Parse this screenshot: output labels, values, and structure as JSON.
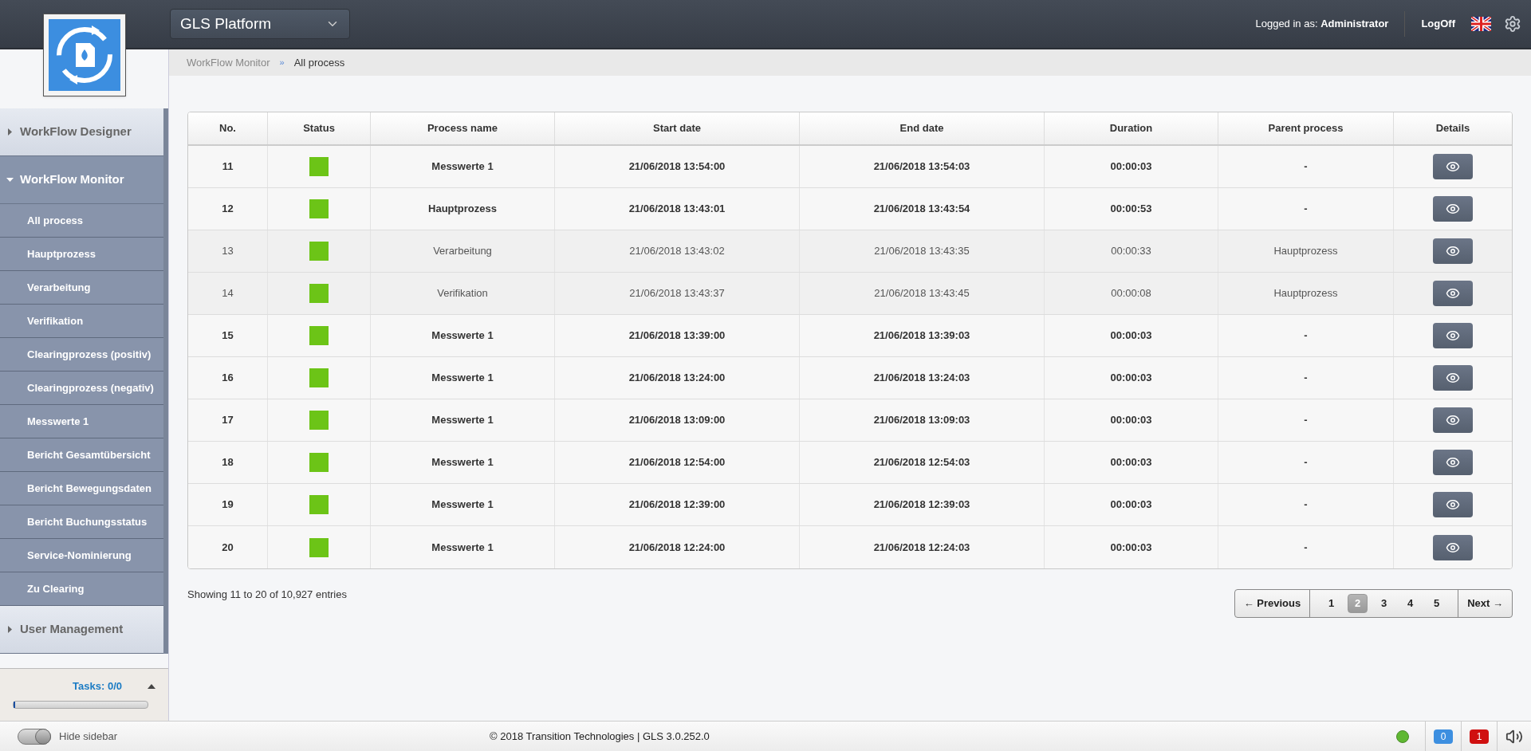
{
  "header": {
    "platform_select": "GLS Platform",
    "logged_in_label": "Logged in as:",
    "user": "Administrator",
    "logoff": "LogOff"
  },
  "breadcrumb": [
    "WorkFlow Monitor",
    "»",
    "All process"
  ],
  "sidebar": {
    "sections": [
      {
        "label": "WorkFlow Designer",
        "expanded": false
      },
      {
        "label": "WorkFlow Monitor",
        "expanded": true,
        "children": [
          {
            "label": "All process"
          },
          {
            "label": "Hauptprozess"
          },
          {
            "label": "Verarbeitung"
          },
          {
            "label": "Verifikation"
          },
          {
            "label": "Clearingprozess (positiv)"
          },
          {
            "label": "Clearingprozess (negativ)"
          },
          {
            "label": "Messwerte 1"
          },
          {
            "label": "Bericht Gesamtübersicht"
          },
          {
            "label": "Bericht Bewegungsdaten"
          },
          {
            "label": "Bericht Buchungsstatus"
          },
          {
            "label": "Service-Nominierung"
          },
          {
            "label": "Zu Clearing"
          }
        ]
      },
      {
        "label": "User Management",
        "expanded": false
      }
    ],
    "tasks": {
      "label": "Tasks: 0/0",
      "level": 0.01
    }
  },
  "table": {
    "columns": [
      "No.",
      "Status",
      "Process name",
      "Start date",
      "End date",
      "Duration",
      "Parent process",
      "Details"
    ],
    "rows": [
      {
        "kind": "main",
        "no": "11",
        "color": "#6cc417",
        "name": "Messwerte 1",
        "start": "21/06/2018 13:54:00",
        "end": "21/06/2018 13:54:03",
        "duration": "00:00:03",
        "parent": "-"
      },
      {
        "kind": "main",
        "no": "12",
        "color": "#6cc417",
        "name": "Hauptprozess",
        "start": "21/06/2018 13:43:01",
        "end": "21/06/2018 13:43:54",
        "duration": "00:00:53",
        "parent": "-"
      },
      {
        "kind": "sub",
        "no": "13",
        "color": "#6cc417",
        "name": "Verarbeitung",
        "start": "21/06/2018 13:43:02",
        "end": "21/06/2018 13:43:35",
        "duration": "00:00:33",
        "parent": "Hauptprozess"
      },
      {
        "kind": "sub",
        "no": "14",
        "color": "#6cc417",
        "name": "Verifikation",
        "start": "21/06/2018 13:43:37",
        "end": "21/06/2018 13:43:45",
        "duration": "00:00:08",
        "parent": "Hauptprozess"
      },
      {
        "kind": "main",
        "no": "15",
        "color": "#6cc417",
        "name": "Messwerte 1",
        "start": "21/06/2018 13:39:00",
        "end": "21/06/2018 13:39:03",
        "duration": "00:00:03",
        "parent": "-"
      },
      {
        "kind": "main",
        "no": "16",
        "color": "#6cc417",
        "name": "Messwerte 1",
        "start": "21/06/2018 13:24:00",
        "end": "21/06/2018 13:24:03",
        "duration": "00:00:03",
        "parent": "-"
      },
      {
        "kind": "main",
        "no": "17",
        "color": "#6cc417",
        "name": "Messwerte 1",
        "start": "21/06/2018 13:09:00",
        "end": "21/06/2018 13:09:03",
        "duration": "00:00:03",
        "parent": "-"
      },
      {
        "kind": "main",
        "no": "18",
        "color": "#6cc417",
        "name": "Messwerte 1",
        "start": "21/06/2018 12:54:00",
        "end": "21/06/2018 12:54:03",
        "duration": "00:00:03",
        "parent": "-"
      },
      {
        "kind": "main",
        "no": "19",
        "color": "#6cc417",
        "name": "Messwerte 1",
        "start": "21/06/2018 12:39:00",
        "end": "21/06/2018 12:39:03",
        "duration": "00:00:03",
        "parent": "-"
      },
      {
        "kind": "main",
        "no": "20",
        "color": "#6cc417",
        "name": "Messwerte 1",
        "start": "21/06/2018 12:24:00",
        "end": "21/06/2018 12:24:03",
        "duration": "00:00:03",
        "parent": "-"
      }
    ]
  },
  "info": "Showing 11 to 20 of 10,927 entries",
  "pagination": {
    "previous": "← Previous",
    "next": "Next →",
    "pages": [
      {
        "label": "1",
        "selected": false
      },
      {
        "label": "2",
        "selected": true
      },
      {
        "label": "3",
        "selected": false
      },
      {
        "label": "4",
        "selected": false
      },
      {
        "label": "5",
        "selected": false
      }
    ]
  },
  "footer": {
    "hide_sidebar": {
      "label": "Hide sidebar",
      "on": true
    },
    "copyright": "© 2018 Transition Technologies | GLS 3.0.252.0",
    "online": true,
    "badges": [
      {
        "count": "0",
        "color": "#3d8fe0"
      },
      {
        "count": "1",
        "color": "#d01010"
      }
    ]
  }
}
